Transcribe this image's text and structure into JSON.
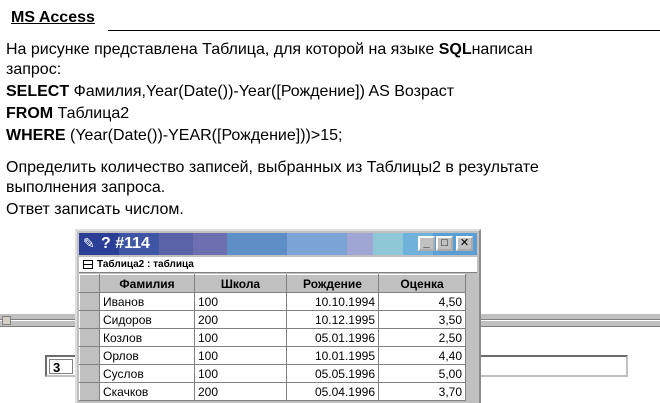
{
  "task": {
    "title": "MS Access",
    "intro_line1_a": "На рисунке представлена Таблица, для которой на языке ",
    "intro_line1_sql": "SQL",
    "intro_line1_b": "написан",
    "intro_line2": "запрос:",
    "select_kw": "SELECT",
    "select_rest": " Фамилия,Year(Date())-Year([Рождение]) AS Возраст",
    "from_kw": "FROM",
    "from_rest": " Таблица2",
    "where_kw": "WHERE",
    "where_rest": " (Year(Date())-YEAR([Рождение]))>15;",
    "question_line1": "Определить количество записей, выбранных из Таблицы2 в результате",
    "question_line2": "выполнения запроса.",
    "question_line3": "Ответ записать числом."
  },
  "answer": {
    "value": "3"
  },
  "window": {
    "title": "? #114",
    "title_icon": "pencil-icon",
    "subtitle": "Таблица2 : таблица",
    "table_icon": "table-icon",
    "titlebar_colors": [
      "#2b3f97",
      "#3f55a6",
      "#5a63a8",
      "#6d6fb0",
      "#5e8ec6",
      "#7ba3d6",
      "#9fa6d4",
      "#8ec7d6",
      "#6fb1da",
      "#5a9ed6"
    ],
    "columns": [
      "Фамилия",
      "Школа",
      "Рождение",
      "Оценка"
    ],
    "rows": [
      [
        "Иванов",
        "100",
        "10.10.1994",
        "4,50"
      ],
      [
        "Сидоров",
        "200",
        "10.12.1995",
        "3,50"
      ],
      [
        "Козлов",
        "100",
        "05.01.1996",
        "2,50"
      ],
      [
        "Орлов",
        "100",
        "10.01.1995",
        "4,40"
      ],
      [
        "Суслов",
        "100",
        "05.05.1996",
        "5,00"
      ],
      [
        "Скачков",
        "200",
        "05.04.1996",
        "3,70"
      ]
    ]
  }
}
